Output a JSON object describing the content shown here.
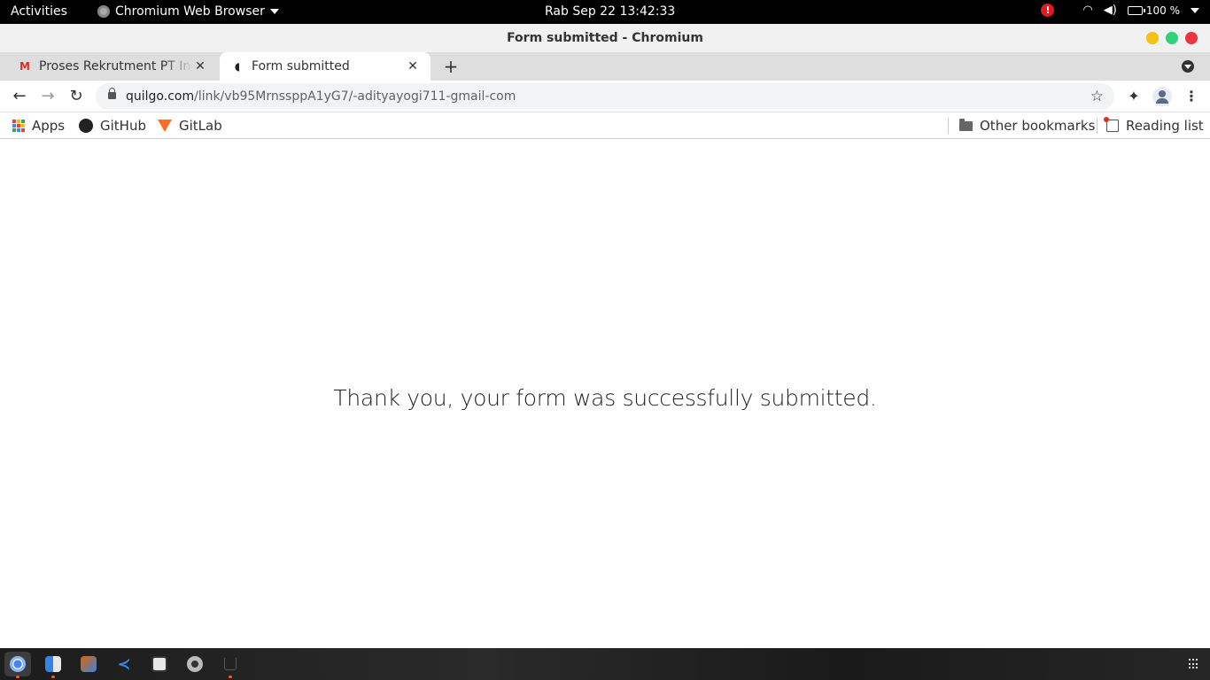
{
  "topbar": {
    "activities": "Activities",
    "app_name": "Chromium Web Browser",
    "clock": "Rab Sep 22  13:42:33",
    "battery": "100 %"
  },
  "window": {
    "title": "Form submitted - Chromium"
  },
  "tabs": [
    {
      "title": "Proses Rekrutment PT Indo",
      "icon": "gmail-icon",
      "active": false
    },
    {
      "title": "Form submitted",
      "icon": "form-icon",
      "active": true
    }
  ],
  "toolbar": {
    "url_host": "quilgo.com",
    "url_path": "/link/vb95MrnssppA1yG7/-adityayogi711-gmail-com"
  },
  "bookmarks": {
    "items": [
      "Apps",
      "GitHub",
      "GitLab"
    ],
    "other": "Other bookmarks",
    "reading_list": "Reading list"
  },
  "page": {
    "message": "Thank you, your form was successfully submitted."
  },
  "dock": {
    "items": [
      "chromium",
      "finder",
      "software",
      "vscode",
      "inkscape",
      "settings",
      "trash"
    ]
  },
  "colors": {
    "accent": "#e95420",
    "alert": "#e01b24"
  }
}
